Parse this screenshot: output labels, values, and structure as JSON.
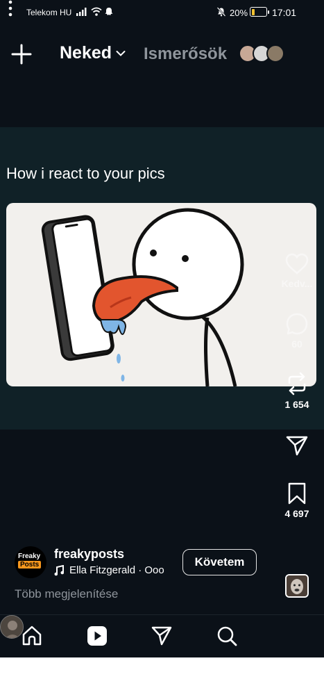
{
  "status_bar": {
    "carrier": "Telekom HU",
    "battery_percent": "20%",
    "battery_level": 0.2,
    "time": "17:01",
    "icons": [
      "signal-icon",
      "wifi-icon",
      "snapchat-ghost-icon",
      "mute-bell-icon",
      "battery-icon"
    ]
  },
  "top_nav": {
    "create_icon": "plus-icon",
    "tab_for_you": "Neked",
    "tab_friends": "Ismerősök"
  },
  "reel": {
    "caption": "How i react to your pics",
    "image_description_icon": "meme-image",
    "actions": {
      "like_label": "Kedv...",
      "comment_count": "60",
      "repost_count": "1 654",
      "save_count": "4 697"
    }
  },
  "author": {
    "avatar_line1": "Freaky",
    "avatar_line2": "Posts",
    "username": "freakyposts",
    "music": "Ella Fitzgerald · Ooo",
    "follow_label": "Követem",
    "show_more": "Több megjelenítése"
  },
  "bottom_nav": {
    "items": [
      "home-icon",
      "reels-icon",
      "messages-icon",
      "search-icon",
      "profile-avatar"
    ]
  },
  "colors": {
    "background": "#0b1118",
    "reel_panel": "#102127",
    "muted_text": "#8f959c",
    "tongue": "#e2552e",
    "battery": "#f2c230"
  }
}
